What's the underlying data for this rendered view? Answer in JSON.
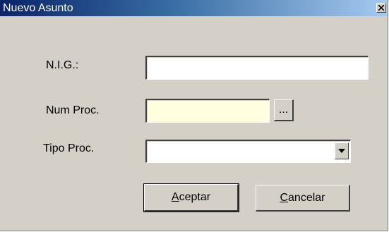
{
  "window": {
    "title": "Nuevo Asunto"
  },
  "form": {
    "nig_label": "N.I.G.:",
    "nig_value": "",
    "num_proc_label": "Num Proc.",
    "num_proc_value": "",
    "browse_label": "...",
    "tipo_proc_label": "Tipo Proc.",
    "tipo_proc_value": ""
  },
  "buttons": {
    "aceptar_accel": "A",
    "aceptar_rest": "ceptar",
    "cancelar_accel": "C",
    "cancelar_rest": "ancelar"
  },
  "icons": {
    "close": "close-icon",
    "dropdown": "chevron-down-icon"
  },
  "colors": {
    "title_gradient_start": "#0a246a",
    "title_gradient_end": "#a6caf0",
    "window_bg": "#d4d0c8",
    "num_proc_bg": "#ffffe0"
  }
}
